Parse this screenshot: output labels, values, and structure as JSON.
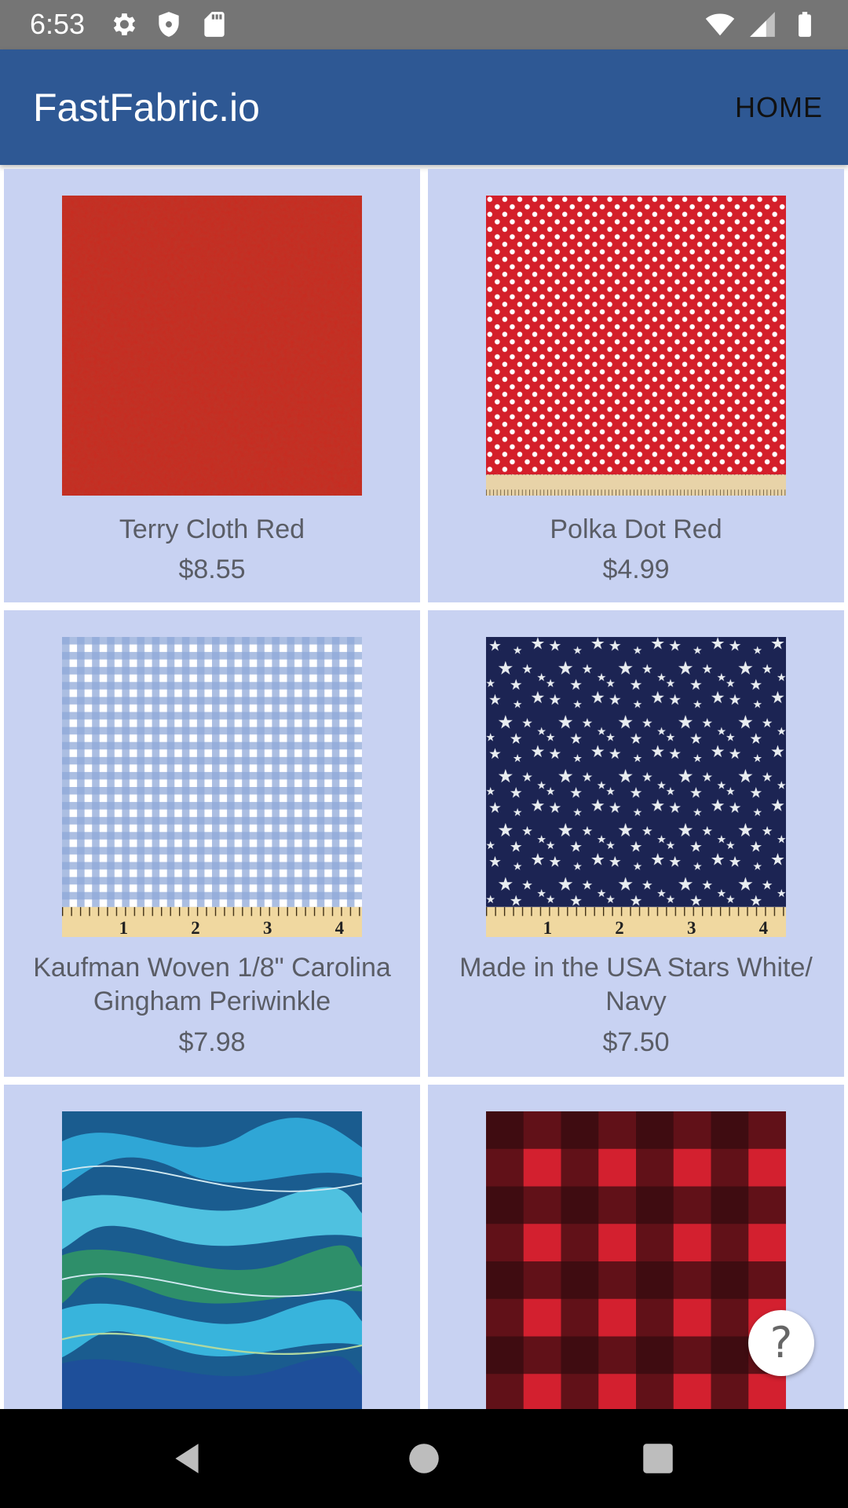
{
  "status_bar": {
    "time": "6:53",
    "left_icons": [
      "gear-icon",
      "shield-icon",
      "sd-card-icon"
    ],
    "right_icons": [
      "wifi-icon",
      "signal-icon",
      "battery-icon"
    ]
  },
  "app_bar": {
    "title": "FastFabric.io",
    "home_label": "HOME",
    "color": "#2e5894"
  },
  "products": [
    {
      "name": "Terry Cloth Red",
      "price": "$8.55",
      "pattern": "terry-cloth"
    },
    {
      "name": "Polka Dot Red",
      "price": "$4.99",
      "pattern": "polka-dot"
    },
    {
      "name": "Kaufman Woven 1/8\" Carolina Gingham Periwinkle",
      "price": "$7.98",
      "pattern": "gingham"
    },
    {
      "name": "Made in the USA Stars White/ Navy",
      "price": "$7.50",
      "pattern": "stars"
    },
    {
      "name": "",
      "price": "",
      "pattern": "blue-waves"
    },
    {
      "name": "",
      "price": "",
      "pattern": "buffalo-plaid"
    }
  ],
  "help_button": {
    "icon": "question-mark-icon",
    "glyph": "?"
  },
  "nav_bar": {
    "icons": [
      "back-icon",
      "home-circle-icon",
      "recents-icon"
    ]
  }
}
